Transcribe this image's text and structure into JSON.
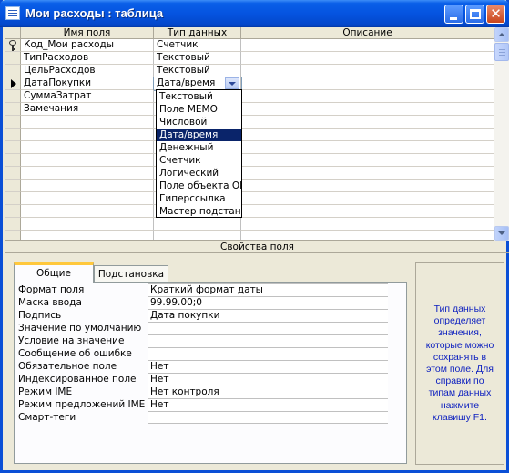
{
  "window": {
    "title": "Мои расходы : таблица",
    "accent": "#0554e0"
  },
  "grid": {
    "columns": [
      "Имя поля",
      "Тип данных",
      "Описание"
    ],
    "rows": [
      {
        "name": "Код_Мои расходы",
        "type": "Счетчик",
        "primary_key": true
      },
      {
        "name": "ТипРасходов",
        "type": "Текстовый"
      },
      {
        "name": "ЦельРасходов",
        "type": "Текстовый"
      },
      {
        "name": "ДатаПокупки",
        "type": "Дата/время",
        "current": true
      },
      {
        "name": "СуммаЗатрат",
        "type": ""
      },
      {
        "name": "Замечания",
        "type": ""
      }
    ]
  },
  "type_dropdown": {
    "selected": "Дата/время",
    "options": [
      "Текстовый",
      "Поле MEMO",
      "Числовой",
      "Дата/время",
      "Денежный",
      "Счетчик",
      "Логический",
      "Поле объекта OLE",
      "Гиперссылка",
      "Мастер подстановок..."
    ]
  },
  "properties": {
    "caption": "Свойства поля",
    "tabs": [
      "Общие",
      "Подстановка"
    ],
    "rows": [
      {
        "label": "Формат поля",
        "value": "Краткий формат даты"
      },
      {
        "label": "Маска ввода",
        "value": "99.99.00;0"
      },
      {
        "label": "Подпись",
        "value": "Дата покупки"
      },
      {
        "label": "Значение по умолчанию",
        "value": ""
      },
      {
        "label": "Условие на значение",
        "value": ""
      },
      {
        "label": "Сообщение об ошибке",
        "value": ""
      },
      {
        "label": "Обязательное поле",
        "value": "Нет"
      },
      {
        "label": "Индексированное поле",
        "value": "Нет"
      },
      {
        "label": "Режим IME",
        "value": "Нет контроля"
      },
      {
        "label": "Режим предложений IME",
        "value": "Нет"
      },
      {
        "label": "Смарт-теги",
        "value": ""
      }
    ],
    "help_text": "Тип данных определяет значения, которые можно сохранять в этом поле. Для справки по типам данных нажмите клавишу F1."
  }
}
